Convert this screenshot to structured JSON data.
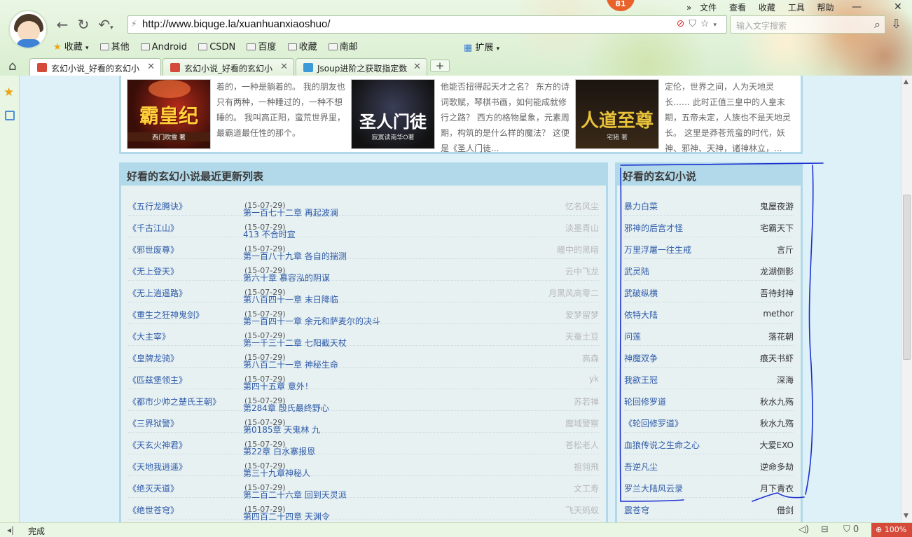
{
  "browser": {
    "url": "http://www.biquge.la/xuanhuanxiaoshuo/",
    "menu": [
      "文件",
      "查看",
      "收藏",
      "工具",
      "帮助"
    ],
    "badge": "81",
    "search_placeholder": "输入文字搜索",
    "favorites": {
      "label": "收藏",
      "items": [
        "其他",
        "Android",
        "CSDN",
        "百度",
        "收藏",
        "南邮"
      ]
    },
    "extensions_label": "扩展",
    "tabs": [
      {
        "title": "玄幻小说_好看的玄幻小",
        "active": true
      },
      {
        "title": "玄幻小说_好看的玄幻小",
        "active": false
      },
      {
        "title": "Jsoup进阶之获取指定数",
        "active": false
      }
    ],
    "status_text": "完成",
    "status_count": "0",
    "zoom": "100%"
  },
  "featured": [
    {
      "cover_title": "霸皇纪",
      "cover_sub": "西门吹雪 著",
      "desc": "着的，一种是躺着的。 我的朋友也只有两种，一种睡过的，一种不想睡的。 我叫高正阳，蛮荒世界里，最霸道最任性的那个。"
    },
    {
      "cover_title": "圣人门徒",
      "cover_sub": "寂寞读南华O著",
      "desc": "他能否扭得起天才之名？ 东方的诗词歌赋，琴棋书画，如何能成就修行之路？ 西方的格物星象，元素周期，构筑的是什么样的魔法？ 这便是《圣人门徒..."
    },
    {
      "cover_title": "人道至尊",
      "cover_sub": "宅猪 著",
      "desc": "定伦，世界之间，人为天地灵长…… 此时正值三皇中的人皇末期，五帝未定，人族也不是天地灵长。 这里是莽苍荒蛮的时代，妖神、邪神、天神，诸神林立，..."
    }
  ],
  "latest": {
    "title": "好看的玄幻小说最近更新列表",
    "rows": [
      {
        "name": "《五行龙腾诀》",
        "chapter": "第一百七十二章 再起波澜",
        "date": "(15-07-29)",
        "author": "忆名风尘"
      },
      {
        "name": "《千古江山》",
        "chapter": "413 不合时宜",
        "date": "(15-07-29)",
        "author": "淡墨青山"
      },
      {
        "name": "《邪世废尊》",
        "chapter": "第一百八十九章 各自的揣测",
        "date": "(15-07-29)",
        "author": "瞳中的黑暗"
      },
      {
        "name": "《无上登天》",
        "chapter": "第六十章 慕容泓的阴谋",
        "date": "(15-07-29)",
        "author": "云中飞龙"
      },
      {
        "name": "《无上逍遥路》",
        "chapter": "第八百四十一章 末日降临",
        "date": "(15-07-29)",
        "author": "月黑风高零二"
      },
      {
        "name": "《重生之狂神鬼剑》",
        "chapter": "第一百四十一章 余元和萨麦尔的决斗",
        "date": "(15-07-29)",
        "author": "爱梦留梦"
      },
      {
        "name": "《大主宰》",
        "chapter": "第一千三十二章 七阳截天杖",
        "date": "(15-07-29)",
        "author": "天蚕土豆"
      },
      {
        "name": "《皇牌龙骑》",
        "chapter": "第八百二十一章 神秘生命",
        "date": "(15-07-29)",
        "author": "高森"
      },
      {
        "name": "《匹兹堡领主》",
        "chapter": "第四十五章 意外！",
        "date": "(15-07-29)",
        "author": "yk"
      },
      {
        "name": "《都市少帅之楚氏王朝》",
        "chapter": "第284章 殷氏最终野心",
        "date": "(15-07-29)",
        "author": "苏若禅"
      },
      {
        "name": "《三界狱警》",
        "chapter": "第0185章 天鬼林 九",
        "date": "(15-07-29)",
        "author": "魔域警察"
      },
      {
        "name": "《天玄火神君》",
        "chapter": "第22章 白水寨报恩",
        "date": "(15-07-29)",
        "author": "苍松老人"
      },
      {
        "name": "《天地我逍遥》",
        "chapter": "第三十九章神秘人",
        "date": "(15-07-29)",
        "author": "祖翎飛"
      },
      {
        "name": "《绝灭天道》",
        "chapter": "第二百二十六章 回到天灵派",
        "date": "(15-07-29)",
        "author": "文工寿"
      },
      {
        "name": "《绝世苍穹》",
        "chapter": "第四百二十四章 天渊令",
        "date": "(15-07-29)",
        "author": "飞天蚂蚁"
      }
    ]
  },
  "popular": {
    "title": "好看的玄幻小说",
    "rows": [
      {
        "name": "暴力白菜",
        "author": "鬼屋夜游"
      },
      {
        "name": "邪神的后宫才怪",
        "author": "宅霸天下"
      },
      {
        "name": "万里浮屠一往生戒",
        "author": "言斤"
      },
      {
        "name": "武灵陆",
        "author": "龙湖倒影"
      },
      {
        "name": "武破纵横",
        "author": "吾待封神"
      },
      {
        "name": "依特大陆",
        "author": "methor"
      },
      {
        "name": "问莲",
        "author": "落花朝"
      },
      {
        "name": "神魔双争",
        "author": "痕天书虾"
      },
      {
        "name": "我欲王冠",
        "author": "深海"
      },
      {
        "name": "轮回修罗道",
        "author": "秋水九殇"
      },
      {
        "name": "《轮回修罗道》",
        "author": "秋水九殇"
      },
      {
        "name": "血狼传说之生命之心",
        "author": "大爱EXO"
      },
      {
        "name": "吾逆凡尘",
        "author": "逆命多劫"
      },
      {
        "name": "罗兰大陆风云录",
        "author": "月下青衣"
      },
      {
        "name": "震苍穹",
        "author": "借剑"
      }
    ]
  },
  "colors": {
    "link": "#2e5aa8",
    "panel_header": "#b2d9ea",
    "page_bg": "#def1f8",
    "annotation": "#1a2fd0"
  }
}
